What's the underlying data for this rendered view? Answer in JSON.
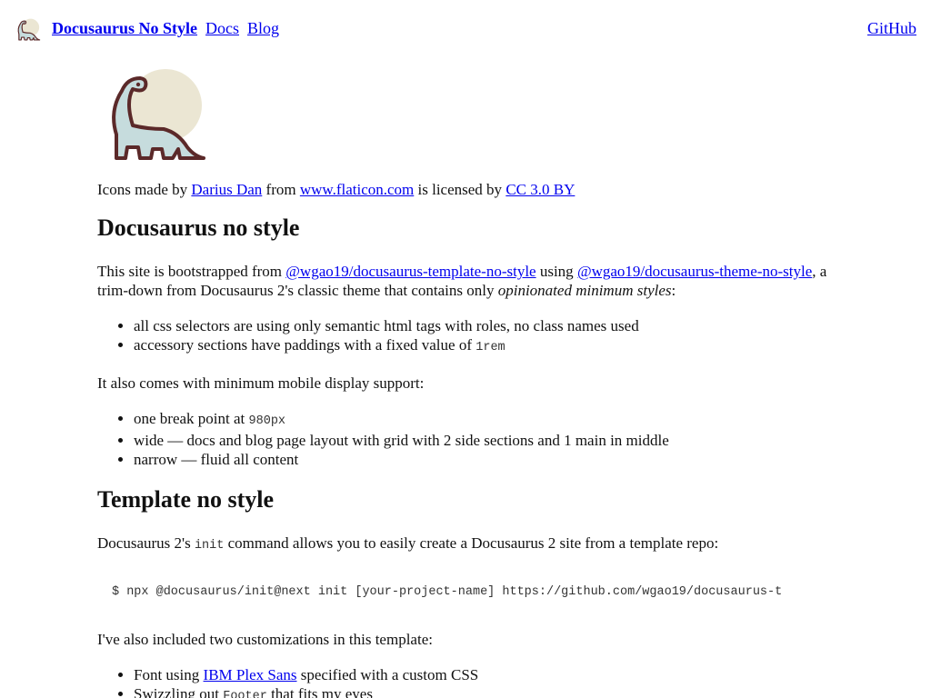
{
  "navbar": {
    "brand": "Docusaurus No Style",
    "links": [
      "Docs",
      "Blog"
    ],
    "github": "GitHub",
    "logo_icon": "dinosaur-icon"
  },
  "hero": {
    "logo_icon": "dinosaur-icon",
    "credits": {
      "prefix": "Icons made by ",
      "author": "Darius Dan",
      "mid1": " from ",
      "site": "www.flaticon.com",
      "mid2": " is licensed by ",
      "license": "CC 3.0 BY"
    }
  },
  "section1": {
    "heading": "Docusaurus no style",
    "intro": {
      "prefix": "This site is bootstrapped from ",
      "link1": "@wgao19/docusaurus-template-no-style",
      "mid": " using ",
      "link2": "@wgao19/docusaurus-theme-no-style",
      "suffix": ", a trim-down from Docusaurus 2's classic theme that contains only ",
      "emphasis": "opinionated minimum styles",
      "end": ":"
    },
    "features": {
      "item1": "all css selectors are using only semantic html tags with roles, no class names used",
      "item2_prefix": "accessory sections have paddings with a fixed value of ",
      "item2_code": "1rem"
    },
    "mobile_intro": "It also comes with minimum mobile display support:",
    "mobile": {
      "item1_prefix": "one break point at ",
      "item1_code": "980px",
      "item2": "wide — docs and blog page layout with grid with 2 side sections and 1 main in middle",
      "item3": "narrow — fluid all content"
    }
  },
  "section2": {
    "heading": "Template no style",
    "init": {
      "prefix": "Docusaurus 2's ",
      "code": "init",
      "suffix": " command allows you to easily create a Docusaurus 2 site from a template repo:"
    },
    "command": "$ npx @docusaurus/init@next init [your-project-name] https://github.com/wgao19/docusaurus-t",
    "custom_intro": "I've also included two customizations in this template:",
    "customizations": {
      "item1_prefix": "Font using ",
      "item1_link": "IBM Plex Sans",
      "item1_suffix": " specified with a custom CSS",
      "item2_prefix": "Swizzling out ",
      "item2_code": "Footer",
      "item2_suffix": " that fits my eyes"
    }
  }
}
